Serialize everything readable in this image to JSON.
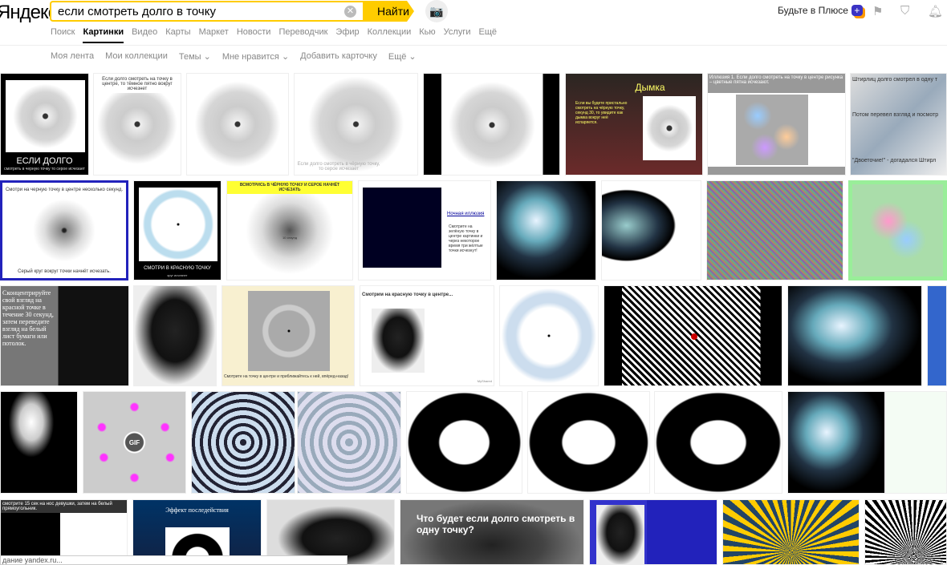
{
  "header": {
    "logo": "Яндекс",
    "search_value": "если смотреть долго в точку",
    "find_label": "Найти",
    "plus_label": "Будьте в Плюсе"
  },
  "nav": [
    "Поиск",
    "Картинки",
    "Видео",
    "Карты",
    "Маркет",
    "Новости",
    "Переводчик",
    "Эфир",
    "Коллекции",
    "Кью",
    "Услуги",
    "Ещё"
  ],
  "subnav": [
    "Моя лента",
    "Мои коллекции",
    "Темы ⌄",
    "Мне нравится ⌄",
    "Добавить карточку",
    "Ещё ⌄"
  ],
  "captions": {
    "r1a": "ЕСЛИ ДОЛГО",
    "r1a2": "смотреть в черную точку то серое исчезает",
    "r1b": "Если долго смотреть на точку в центре, то тёмное пятно вокруг исчезнет",
    "r1d": "Если долго смотреть в чёрную точку, то серое исчезает",
    "r1f": "Дымка",
    "r1f2": "Если вы будете пристально смотреть на чёрную точку, секунд 30, то увидите как дымка вокруг неё испаряется.",
    "r1g": "Иллюзия 1. Если долго смотреть на точку в центре рисунка – цветные пятна исчезают.",
    "r1h": "Штирлиц долго смотрел в одну т",
    "r1h2": "Потом перевел взгляд и посмотр",
    "r1h3": "\"Двоеточие!\" - догадался Штирл",
    "r2a": "Смотри на черную точку в центре несколько секунд.",
    "r2a2": "Серый круг вокруг точки начнёт исчезать.",
    "r2b": "СМОТРИ В КРАСНУЮ ТОЧКУ",
    "r2b2": "круг исчезнет",
    "r2c": "ВСМОТРИСЬ В ЧЁРНУЮ ТОЧКУ И СЕРОЕ НАЧНЁТ ИСЧЕЗАТЬ",
    "r2c2": "10 секунд",
    "r2d": "Ночная иллюзия",
    "r2d2": "Смотрите на зелёную точку в центре картинки и через некоторое время три жёлтые точки исчезнут!",
    "r3a": "Сконцентрируйте свой взгляд на красной точке в течение 30 секунд, затем переведите взгляд на белый лист бумаги или потолок.",
    "r3c": "Смотрите на точку в центре и приближайтесь к ней, впёред-назад!",
    "r3d": "Смотрим на красную точку в центре...",
    "r3d2": "MyShared",
    "r4gif": "GIF",
    "r5a": "смотрите 15 сек на нос девушки, затем на белый прямоугольник.",
    "r5b": "Эффект последействия",
    "r5d": "Что будет если долго смотреть в одну точку?"
  },
  "status": "дание yandex.ru..."
}
